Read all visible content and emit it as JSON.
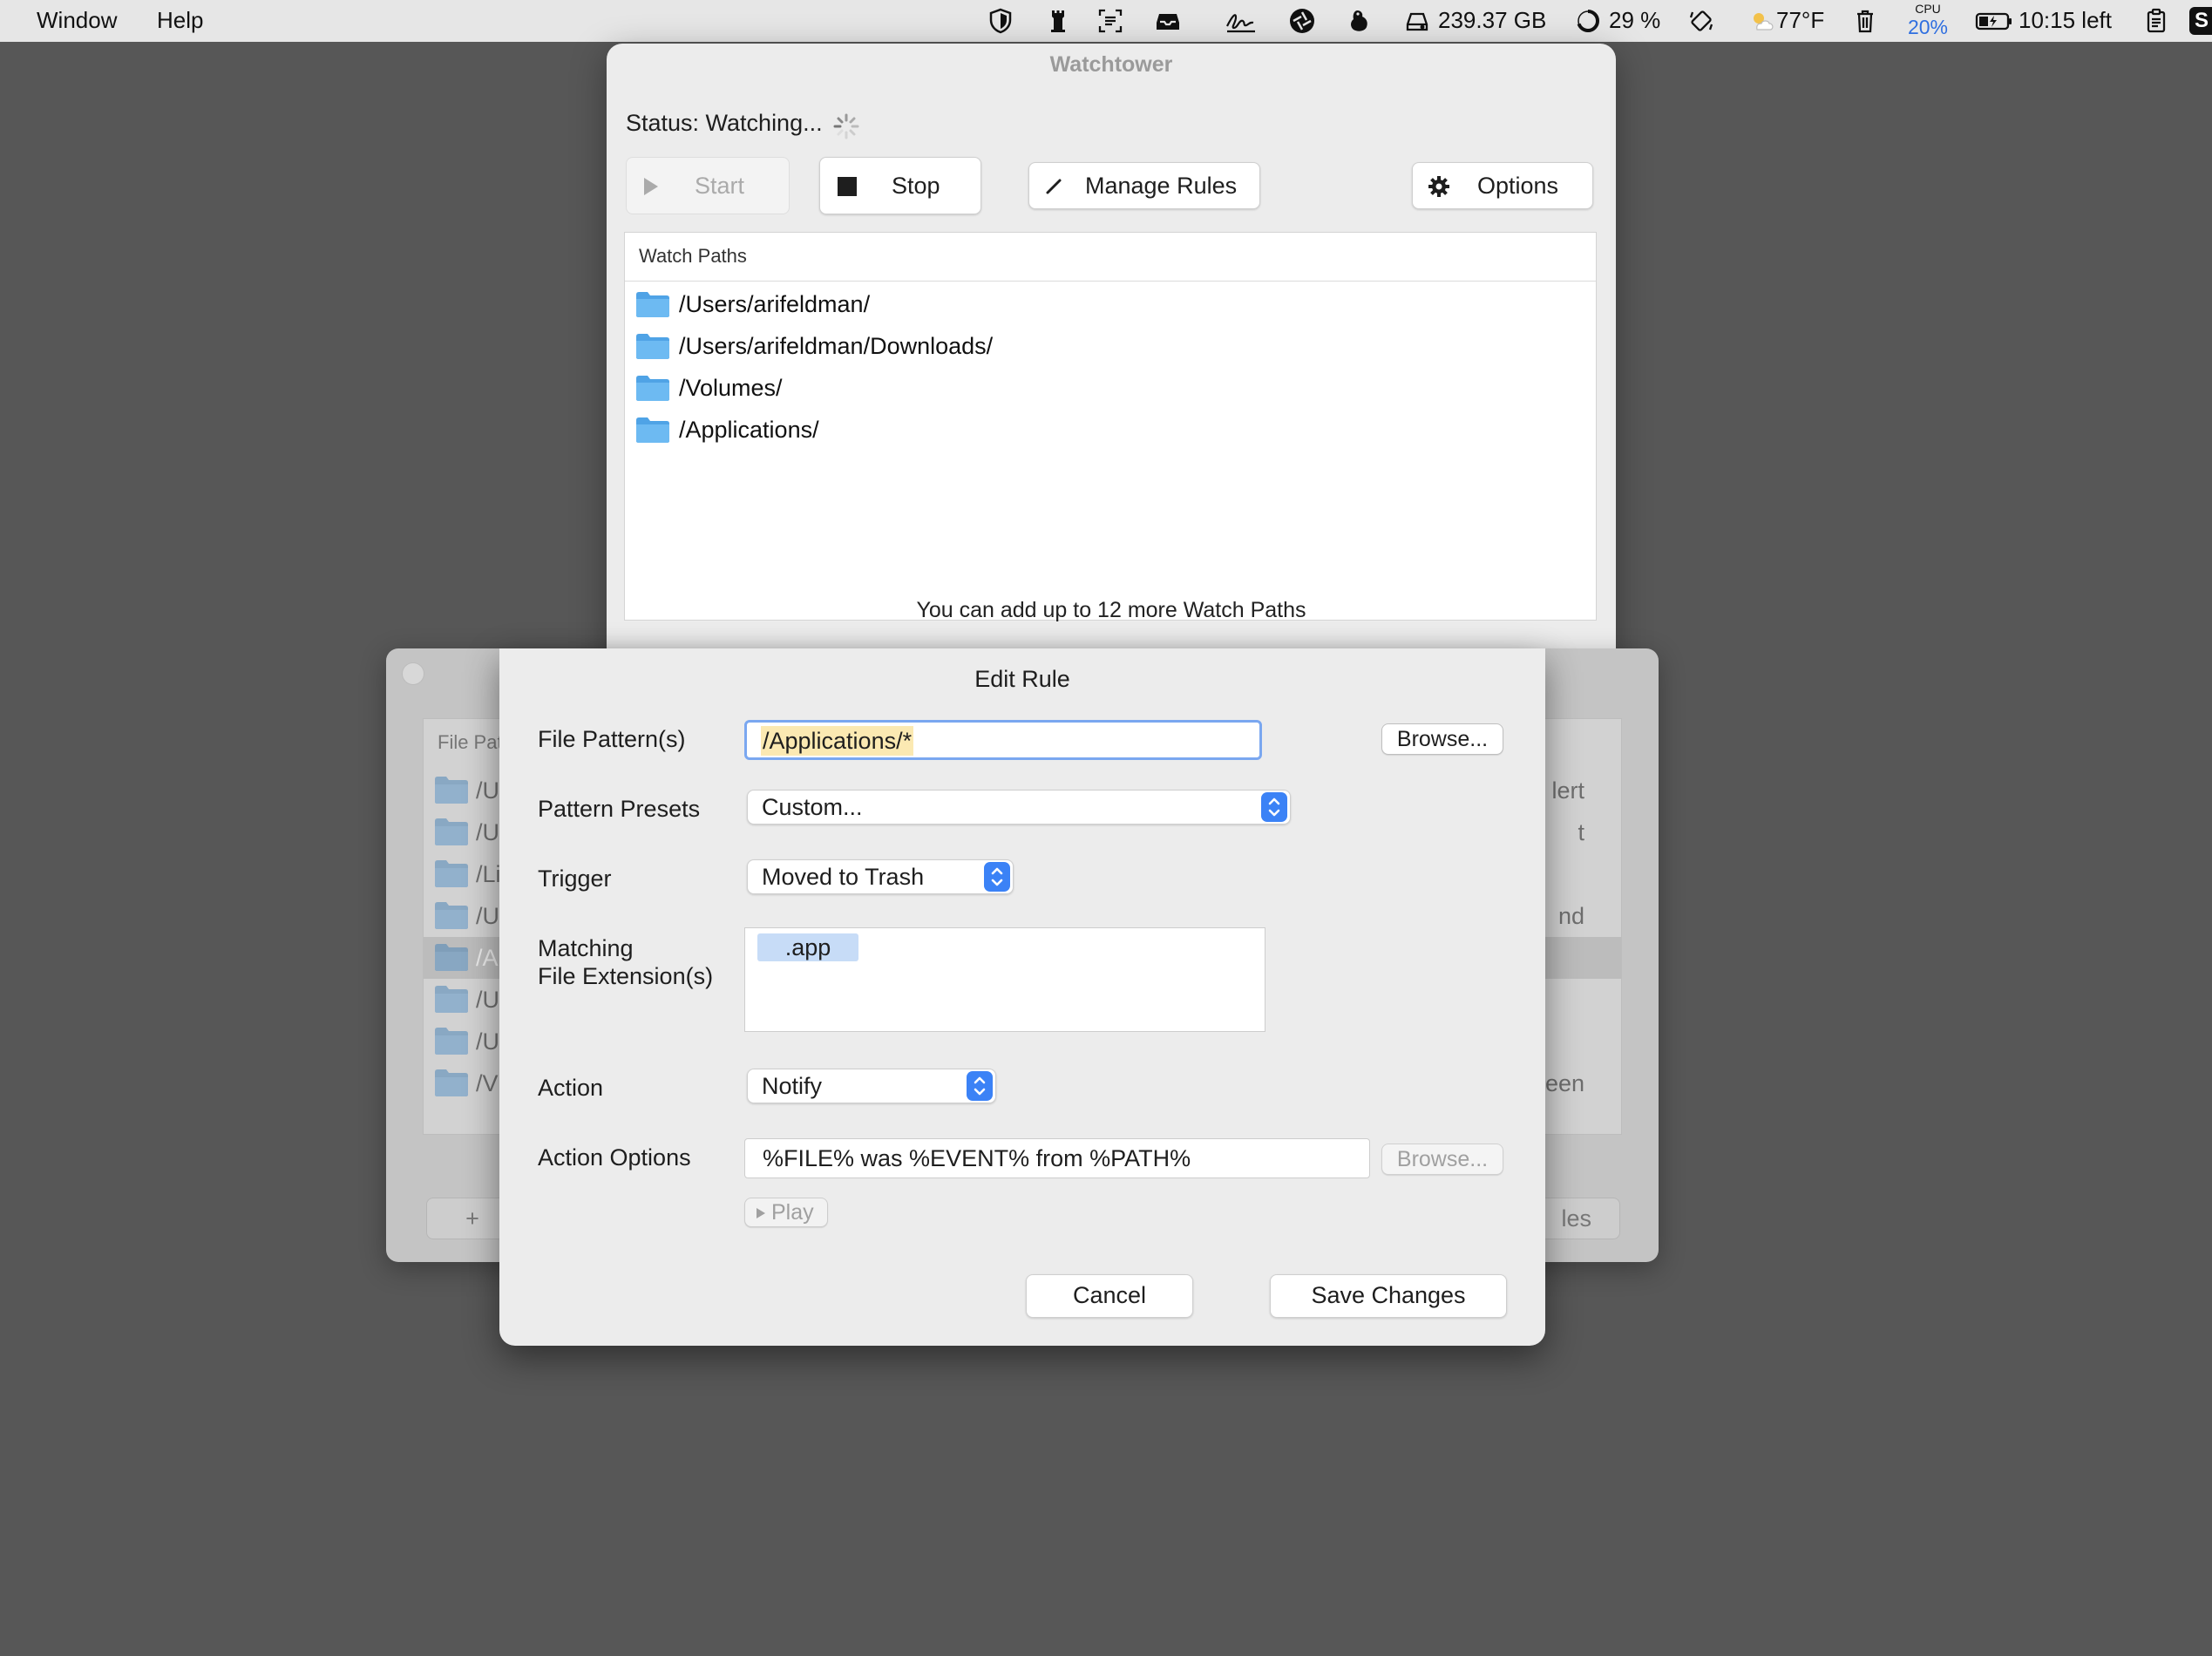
{
  "menubar": {
    "menus": [
      "Window",
      "Help"
    ],
    "storage": "239.37 GB",
    "battery_percent": "29 %",
    "weather": "77°F",
    "cpu_label": "CPU",
    "cpu_value": "20%",
    "battery_time": "10:15 left",
    "last_icon_letter": "S"
  },
  "main_window": {
    "title": "Watchtower",
    "status": "Status: Watching...",
    "buttons": {
      "start": "Start",
      "stop": "Stop",
      "manage_rules": "Manage Rules",
      "options": "Options"
    },
    "paths_header": "Watch Paths",
    "paths": [
      "/Users/arifeldman/",
      "/Users/arifeldman/Downloads/",
      "/Volumes/",
      "/Applications/"
    ],
    "note": "You can add up to 12 more Watch Paths"
  },
  "rules_window": {
    "header": "File Pat",
    "rows": [
      {
        "left": "/U",
        "right": "lert"
      },
      {
        "left": "/U",
        "right": "t"
      },
      {
        "left": "/Li",
        "right": ""
      },
      {
        "left": "/U",
        "right": "nd"
      },
      {
        "left": "/A",
        "right": ""
      },
      {
        "left": "/U",
        "right": ""
      },
      {
        "left": "/U",
        "right": ""
      },
      {
        "left": "/V",
        "right": "een"
      }
    ],
    "add_label": "+",
    "right_button_label": "les"
  },
  "edit_rule": {
    "title": "Edit Rule",
    "labels": {
      "file_pattern": "File Pattern(s)",
      "pattern_presets": "Pattern Presets",
      "trigger": "Trigger",
      "matching_line1": "Matching",
      "matching_line2": "File Extension(s)",
      "action": "Action",
      "action_options": "Action Options"
    },
    "file_pattern_value": "/Applications/*",
    "browse": "Browse...",
    "pattern_preset": "Custom...",
    "trigger": "Moved to Trash",
    "extensions": [
      ".app"
    ],
    "action": "Notify",
    "action_options_value": "%FILE% was %EVENT% from %PATH%",
    "play": "Play",
    "cancel": "Cancel",
    "save": "Save Changes"
  },
  "colors": {
    "accent": "#3b82f6",
    "focus_ring": "#7aa7f0",
    "folder": "#5eb3f0",
    "token": "#c7dcf7",
    "desktop": "#575757"
  }
}
